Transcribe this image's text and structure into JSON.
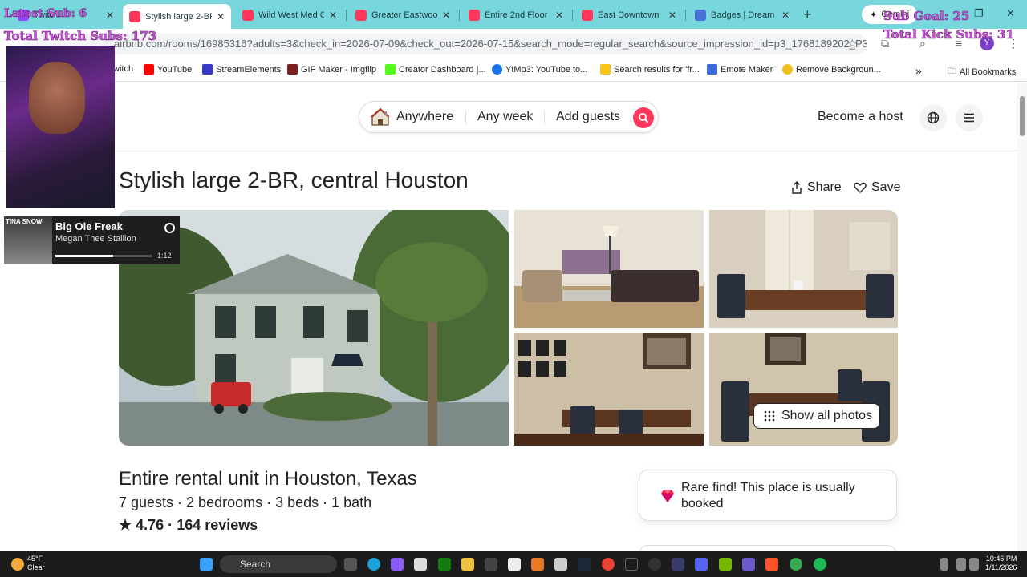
{
  "browser": {
    "tabs": [
      {
        "label": "Twitch",
        "active": false
      },
      {
        "label": "Stylish large 2-BR",
        "active": true
      },
      {
        "label": "Wild West Med C",
        "active": false
      },
      {
        "label": "Greater Eastwoo",
        "active": false
      },
      {
        "label": "Entire 2nd Floor",
        "active": false
      },
      {
        "label": "East Downtown",
        "active": false
      },
      {
        "label": "Badges | Dream",
        "active": false
      }
    ],
    "gemini_label": "Gemini",
    "url": "airbnb.com/rooms/16985316?adults=3&check_in=2026-07-09&check_out=2026-07-15&search_mode=regular_search&source_impression_id=p3_1768189202_P3yCUo...",
    "profile_initial": "Y",
    "bookmarks": [
      {
        "label": "witch"
      },
      {
        "label": "YouTube"
      },
      {
        "label": "StreamElements"
      },
      {
        "label": "GIF Maker - Imgflip"
      },
      {
        "label": "Creator Dashboard |..."
      },
      {
        "label": "YtMp3: YouTube to..."
      },
      {
        "label": "Search results for 'fr..."
      },
      {
        "label": "Emote Maker"
      },
      {
        "label": "Remove Backgroun..."
      }
    ],
    "all_bookmarks": "All Bookmarks"
  },
  "overlay": {
    "top_left": "Latest Sub: 6",
    "twitch_subs": "Total Twitch Subs: 173",
    "sub_goal": "Sub Goal: 25",
    "kick_subs": "Total Kick Subs: 31"
  },
  "spotify": {
    "song": "Big Ole Freak",
    "artist": "Megan Thee Stallion",
    "time": "-1:12",
    "art_text": "TINA SNOW",
    "progress": 0.6
  },
  "airbnb": {
    "search": {
      "where": "Anywhere",
      "when": "Any week",
      "guests": "Add guests"
    },
    "become_host": "Become a host",
    "title": "Stylish large 2-BR, central Houston",
    "share": "Share",
    "save": "Save",
    "show_all_photos": "Show all photos",
    "subtitle": "Entire rental unit in Houston, Texas",
    "details": "7 guests · 2 bedrooms · 3 beds · 1 bath",
    "rating": "★ 4.76 ·",
    "reviews": "164 reviews",
    "rare_find": "Rare find! This place is usually booked",
    "brand_color": "#ff385c"
  },
  "taskbar": {
    "weather_temp": "45°F",
    "weather_cond": "Clear",
    "search": "Search",
    "time": "10:46 PM",
    "date": "1/11/2026"
  }
}
